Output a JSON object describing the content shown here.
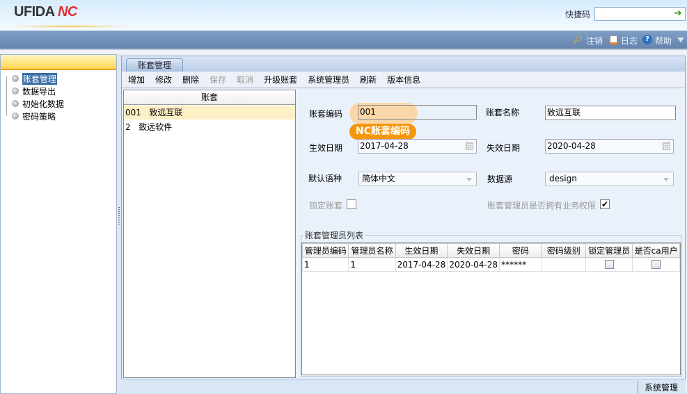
{
  "header": {
    "logo": "UFIDA",
    "logo_suffix": "NC",
    "quick_code_label": "快捷码",
    "quick_code_value": ""
  },
  "topbar": {
    "logout": "注销",
    "log": "日志",
    "help": "帮助"
  },
  "sidebar": {
    "items": [
      {
        "label": "账套管理",
        "selected": true
      },
      {
        "label": "数据导出"
      },
      {
        "label": "初始化数据"
      },
      {
        "label": "密码策略"
      }
    ]
  },
  "tab": {
    "label": "账套管理"
  },
  "toolbar": {
    "items": [
      {
        "label": "增加",
        "enabled": true
      },
      {
        "label": "修改",
        "enabled": true
      },
      {
        "label": "删除",
        "enabled": true
      },
      {
        "label": "保存",
        "enabled": false
      },
      {
        "label": "取消",
        "enabled": false
      },
      {
        "label": "升级账套",
        "enabled": true
      },
      {
        "label": "系统管理员",
        "enabled": true
      },
      {
        "label": "刷新",
        "enabled": true
      },
      {
        "label": "版本信息",
        "enabled": true
      }
    ]
  },
  "list": {
    "header": "账套",
    "rows": [
      {
        "code": "001",
        "name": "致远互联",
        "selected": true
      },
      {
        "code": "2",
        "name": "致远软件"
      }
    ]
  },
  "form": {
    "code_label": "账套编码",
    "code_value": "001",
    "name_label": "账套名称",
    "name_value": "致远互联",
    "start_label": "生效日期",
    "start_value": "2017-04-28",
    "end_label": "失效日期",
    "end_value": "2020-04-28",
    "lang_label": "默认语种",
    "lang_value": "简体中文",
    "ds_label": "数据源",
    "ds_value": "design",
    "lock_label": "锁定账套",
    "lock_checked": false,
    "perm_label": "账套管理员是否拥有业务权限",
    "perm_checked": true,
    "perm_mark": "✔"
  },
  "callout": {
    "text": "NC账套编码",
    "color": "#f7950c"
  },
  "admin_table": {
    "title": "账套管理员列表",
    "columns": [
      "管理员编码",
      "管理员名称",
      "生效日期",
      "失效日期",
      "密码",
      "密码级别",
      "锁定管理员",
      "是否ca用户"
    ],
    "rows": [
      [
        "1",
        "1",
        "2017-04-28",
        "2020-04-28",
        "******",
        ""
      ]
    ]
  },
  "status": {
    "text": "系统管理"
  }
}
